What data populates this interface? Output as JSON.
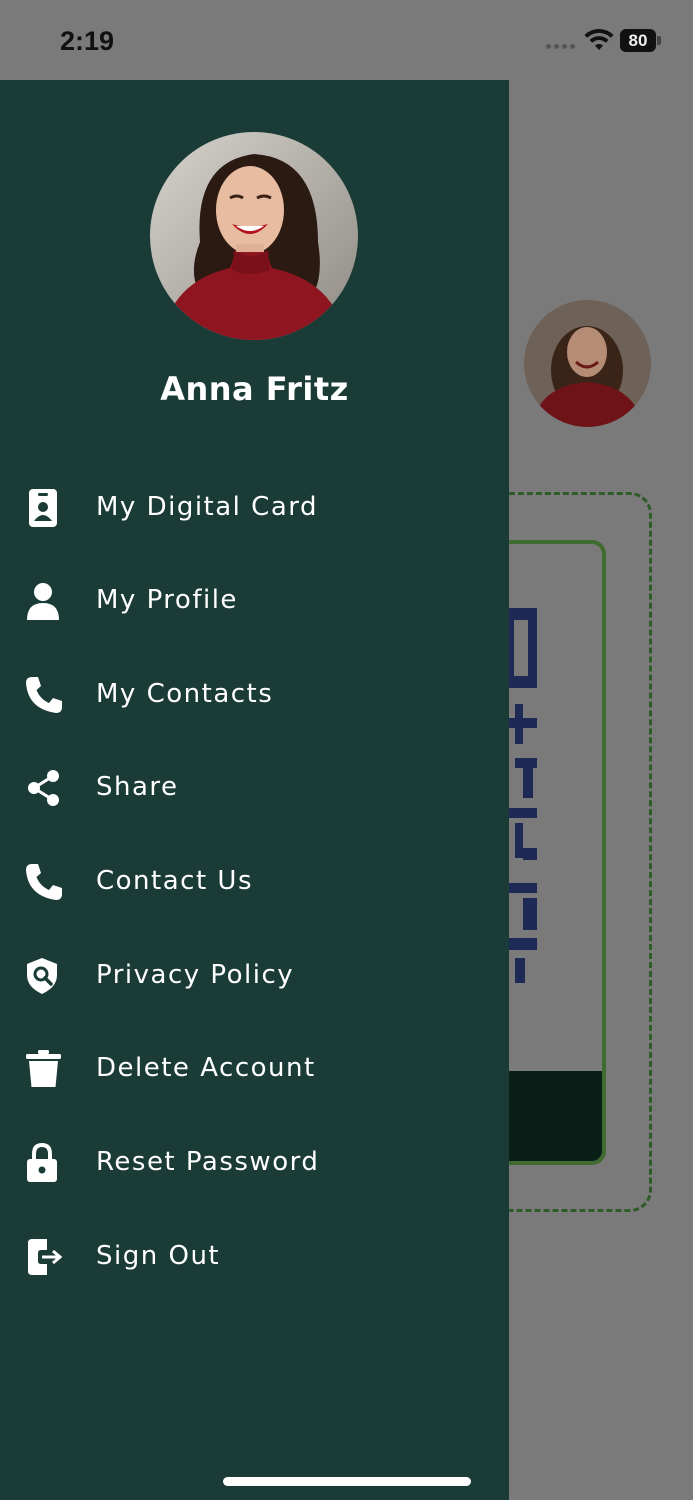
{
  "status_bar": {
    "time": "2:19",
    "battery_level": "80"
  },
  "profile": {
    "name": "Anna Fritz"
  },
  "menu": {
    "items": [
      {
        "label": "My Digital Card",
        "icon": "id-card-icon"
      },
      {
        "label": "My Profile",
        "icon": "person-icon"
      },
      {
        "label": "My Contacts",
        "icon": "phone-icon"
      },
      {
        "label": "Share",
        "icon": "share-icon"
      },
      {
        "label": "Contact Us",
        "icon": "phone-icon"
      },
      {
        "label": "Privacy Policy",
        "icon": "shield-search-icon"
      },
      {
        "label": "Delete Account",
        "icon": "trash-icon"
      },
      {
        "label": "Reset Password",
        "icon": "lock-icon"
      },
      {
        "label": "Sign Out",
        "icon": "sign-out-icon"
      }
    ]
  },
  "colors": {
    "drawer_background": "#1b3b37",
    "scrim": "#7a7a7a",
    "text": "#ffffff",
    "card_footer": "#0a1f18",
    "card_border": "#3f6a30",
    "qr_color": "#1e2a55"
  }
}
